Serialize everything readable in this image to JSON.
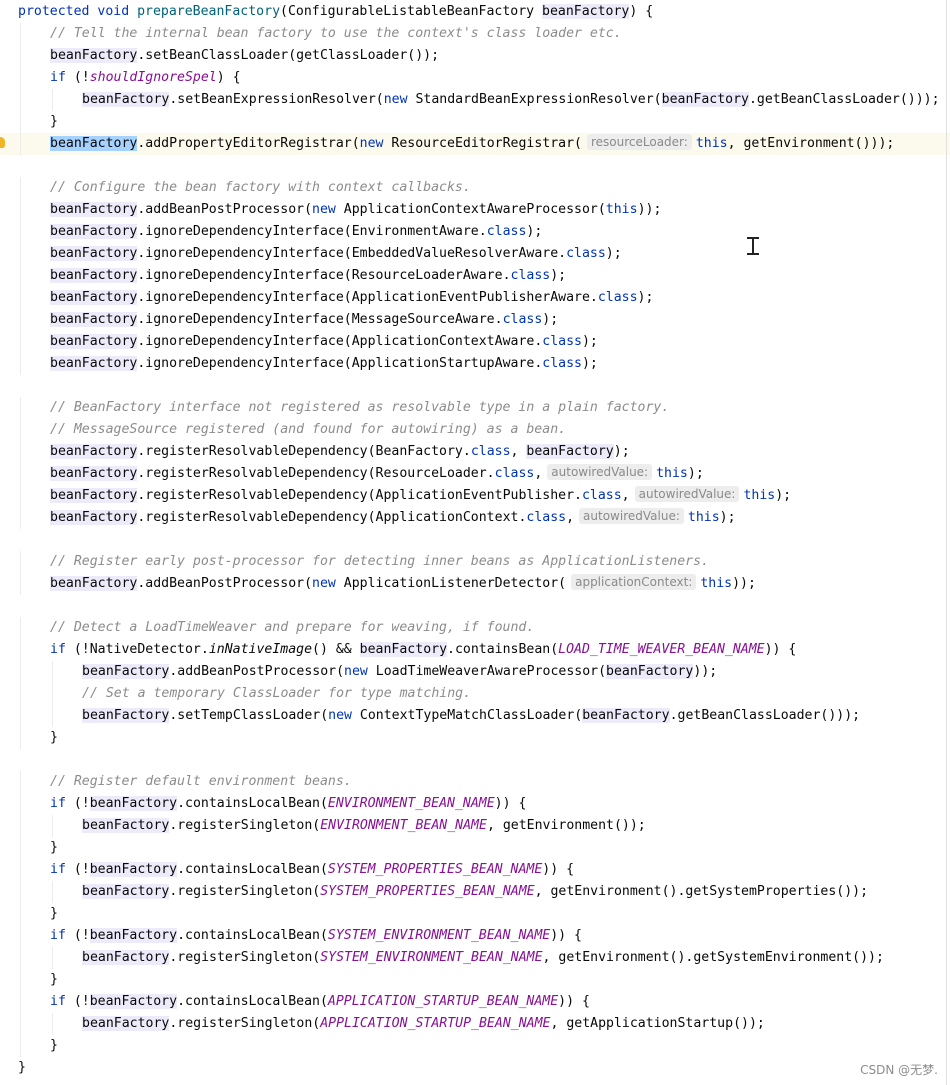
{
  "watermark": "CSDN @无梦.",
  "editor": {
    "caret_line": 6,
    "lines": [
      {
        "indent": 0,
        "tokens": [
          [
            "protected void ",
            "kw"
          ],
          [
            "prepareBeanFactory",
            "method"
          ],
          [
            "(ConfigurableListableBeanFactory ",
            ""
          ],
          [
            "beanFactory",
            "var"
          ],
          [
            ") {",
            ""
          ]
        ]
      },
      {
        "indent": 1,
        "tokens": [
          [
            "// Tell the internal bean factory to use the context's class loader etc.",
            "cm"
          ]
        ]
      },
      {
        "indent": 1,
        "tokens": [
          [
            "beanFactory",
            "var"
          ],
          [
            ".setBeanClassLoader(getClassLoader());",
            ""
          ]
        ]
      },
      {
        "indent": 1,
        "tokens": [
          [
            "if ",
            "kw"
          ],
          [
            "(!",
            ""
          ],
          [
            "shouldIgnoreSpel",
            "fld"
          ],
          [
            ") {",
            ""
          ]
        ]
      },
      {
        "indent": 2,
        "tokens": [
          [
            "beanFactory",
            "var"
          ],
          [
            ".setBeanExpressionResolver(",
            ""
          ],
          [
            "new ",
            "kw"
          ],
          [
            "StandardBeanExpressionResolver(",
            ""
          ],
          [
            "beanFactory",
            "var"
          ],
          [
            ".getBeanClassLoader()));",
            ""
          ]
        ]
      },
      {
        "indent": 1,
        "tokens": [
          [
            "}",
            ""
          ]
        ]
      },
      {
        "indent": 1,
        "tokens": [
          [
            "beanFactory",
            "sel"
          ],
          [
            ".addPropertyEditorRegistrar(",
            ""
          ],
          [
            "new ",
            "kw"
          ],
          [
            "ResourceEditorRegistrar(",
            ""
          ],
          [
            "resourceLoader:",
            "hint"
          ],
          [
            "this",
            "kw"
          ],
          [
            ", getEnvironment()));",
            ""
          ]
        ]
      },
      {
        "indent": 0,
        "tokens": []
      },
      {
        "indent": 1,
        "tokens": [
          [
            "// Configure the bean factory with context callbacks.",
            "cm"
          ]
        ]
      },
      {
        "indent": 1,
        "tokens": [
          [
            "beanFactory",
            "var"
          ],
          [
            ".addBeanPostProcessor(",
            ""
          ],
          [
            "new ",
            "kw"
          ],
          [
            "ApplicationContextAwareProcessor(",
            ""
          ],
          [
            "this",
            "kw"
          ],
          [
            "));",
            ""
          ]
        ]
      },
      {
        "indent": 1,
        "tokens": [
          [
            "beanFactory",
            "var"
          ],
          [
            ".ignoreDependencyInterface(EnvironmentAware.",
            ""
          ],
          [
            "class",
            "kw"
          ],
          [
            ");",
            ""
          ]
        ]
      },
      {
        "indent": 1,
        "tokens": [
          [
            "beanFactory",
            "var"
          ],
          [
            ".ignoreDependencyInterface(EmbeddedValueResolverAware.",
            ""
          ],
          [
            "class",
            "kw"
          ],
          [
            ");",
            ""
          ]
        ]
      },
      {
        "indent": 1,
        "tokens": [
          [
            "beanFactory",
            "var"
          ],
          [
            ".ignoreDependencyInterface(ResourceLoaderAware.",
            ""
          ],
          [
            "class",
            "kw"
          ],
          [
            ");",
            ""
          ]
        ]
      },
      {
        "indent": 1,
        "tokens": [
          [
            "beanFactory",
            "var"
          ],
          [
            ".ignoreDependencyInterface(ApplicationEventPublisherAware.",
            ""
          ],
          [
            "class",
            "kw"
          ],
          [
            ");",
            ""
          ]
        ]
      },
      {
        "indent": 1,
        "tokens": [
          [
            "beanFactory",
            "var"
          ],
          [
            ".ignoreDependencyInterface(MessageSourceAware.",
            ""
          ],
          [
            "class",
            "kw"
          ],
          [
            ");",
            ""
          ]
        ]
      },
      {
        "indent": 1,
        "tokens": [
          [
            "beanFactory",
            "var"
          ],
          [
            ".ignoreDependencyInterface(ApplicationContextAware.",
            ""
          ],
          [
            "class",
            "kw"
          ],
          [
            ");",
            ""
          ]
        ]
      },
      {
        "indent": 1,
        "tokens": [
          [
            "beanFactory",
            "var"
          ],
          [
            ".ignoreDependencyInterface(ApplicationStartupAware.",
            ""
          ],
          [
            "class",
            "kw"
          ],
          [
            ");",
            ""
          ]
        ]
      },
      {
        "indent": 0,
        "tokens": []
      },
      {
        "indent": 1,
        "tokens": [
          [
            "// BeanFactory interface not registered as resolvable type in a plain factory.",
            "cm"
          ]
        ]
      },
      {
        "indent": 1,
        "tokens": [
          [
            "// MessageSource registered (and found for autowiring) as a bean.",
            "cm"
          ]
        ]
      },
      {
        "indent": 1,
        "tokens": [
          [
            "beanFactory",
            "var"
          ],
          [
            ".registerResolvableDependency(BeanFactory.",
            ""
          ],
          [
            "class",
            "kw"
          ],
          [
            ", ",
            ""
          ],
          [
            "beanFactory",
            "var"
          ],
          [
            ");",
            ""
          ]
        ]
      },
      {
        "indent": 1,
        "tokens": [
          [
            "beanFactory",
            "var"
          ],
          [
            ".registerResolvableDependency(ResourceLoader.",
            ""
          ],
          [
            "class",
            "kw"
          ],
          [
            ",",
            ""
          ],
          [
            "autowiredValue:",
            "hint"
          ],
          [
            "this",
            "kw"
          ],
          [
            ");",
            ""
          ]
        ]
      },
      {
        "indent": 1,
        "tokens": [
          [
            "beanFactory",
            "var"
          ],
          [
            ".registerResolvableDependency(ApplicationEventPublisher.",
            ""
          ],
          [
            "class",
            "kw"
          ],
          [
            ",",
            ""
          ],
          [
            "autowiredValue:",
            "hint"
          ],
          [
            "this",
            "kw"
          ],
          [
            ");",
            ""
          ]
        ]
      },
      {
        "indent": 1,
        "tokens": [
          [
            "beanFactory",
            "var"
          ],
          [
            ".registerResolvableDependency(ApplicationContext.",
            ""
          ],
          [
            "class",
            "kw"
          ],
          [
            ",",
            ""
          ],
          [
            "autowiredValue:",
            "hint"
          ],
          [
            "this",
            "kw"
          ],
          [
            ");",
            ""
          ]
        ]
      },
      {
        "indent": 0,
        "tokens": []
      },
      {
        "indent": 1,
        "tokens": [
          [
            "// Register early post-processor for detecting inner beans as ApplicationListeners.",
            "cm"
          ]
        ]
      },
      {
        "indent": 1,
        "tokens": [
          [
            "beanFactory",
            "var"
          ],
          [
            ".addBeanPostProcessor(",
            ""
          ],
          [
            "new ",
            "kw"
          ],
          [
            "ApplicationListenerDetector(",
            ""
          ],
          [
            "applicationContext:",
            "hint"
          ],
          [
            "this",
            "kw"
          ],
          [
            "));",
            ""
          ]
        ]
      },
      {
        "indent": 0,
        "tokens": []
      },
      {
        "indent": 1,
        "tokens": [
          [
            "// Detect a LoadTimeWeaver and prepare for weaving, if found.",
            "cm"
          ]
        ]
      },
      {
        "indent": 1,
        "tokens": [
          [
            "if ",
            "kw"
          ],
          [
            "(!NativeDetector.",
            ""
          ],
          [
            "inNativeImage",
            "ital"
          ],
          [
            "() && ",
            ""
          ],
          [
            "beanFactory",
            "var"
          ],
          [
            ".containsBean(",
            ""
          ],
          [
            "LOAD_TIME_WEAVER_BEAN_NAME",
            "fld"
          ],
          [
            ")) {",
            ""
          ]
        ]
      },
      {
        "indent": 2,
        "tokens": [
          [
            "beanFactory",
            "var"
          ],
          [
            ".addBeanPostProcessor(",
            ""
          ],
          [
            "new ",
            "kw"
          ],
          [
            "LoadTimeWeaverAwareProcessor(",
            ""
          ],
          [
            "beanFactory",
            "var"
          ],
          [
            "));",
            ""
          ]
        ]
      },
      {
        "indent": 2,
        "tokens": [
          [
            "// Set a temporary ClassLoader for type matching.",
            "cm"
          ]
        ]
      },
      {
        "indent": 2,
        "tokens": [
          [
            "beanFactory",
            "var"
          ],
          [
            ".setTempClassLoader(",
            ""
          ],
          [
            "new ",
            "kw"
          ],
          [
            "ContextTypeMatchClassLoader(",
            ""
          ],
          [
            "beanFactory",
            "var"
          ],
          [
            ".getBeanClassLoader()));",
            ""
          ]
        ]
      },
      {
        "indent": 1,
        "tokens": [
          [
            "}",
            ""
          ]
        ]
      },
      {
        "indent": 0,
        "tokens": []
      },
      {
        "indent": 1,
        "tokens": [
          [
            "// Register default environment beans.",
            "cm"
          ]
        ]
      },
      {
        "indent": 1,
        "tokens": [
          [
            "if ",
            "kw"
          ],
          [
            "(!",
            ""
          ],
          [
            "beanFactory",
            "var"
          ],
          [
            ".containsLocalBean(",
            ""
          ],
          [
            "ENVIRONMENT_BEAN_NAME",
            "fld"
          ],
          [
            ")) {",
            ""
          ]
        ]
      },
      {
        "indent": 2,
        "tokens": [
          [
            "beanFactory",
            "var"
          ],
          [
            ".registerSingleton(",
            ""
          ],
          [
            "ENVIRONMENT_BEAN_NAME",
            "fld"
          ],
          [
            ", getEnvironment());",
            ""
          ]
        ]
      },
      {
        "indent": 1,
        "tokens": [
          [
            "}",
            ""
          ]
        ]
      },
      {
        "indent": 1,
        "tokens": [
          [
            "if ",
            "kw"
          ],
          [
            "(!",
            ""
          ],
          [
            "beanFactory",
            "var"
          ],
          [
            ".containsLocalBean(",
            ""
          ],
          [
            "SYSTEM_PROPERTIES_BEAN_NAME",
            "fld"
          ],
          [
            ")) {",
            ""
          ]
        ]
      },
      {
        "indent": 2,
        "tokens": [
          [
            "beanFactory",
            "var"
          ],
          [
            ".registerSingleton(",
            ""
          ],
          [
            "SYSTEM_PROPERTIES_BEAN_NAME",
            "fld"
          ],
          [
            ", getEnvironment().getSystemProperties());",
            ""
          ]
        ]
      },
      {
        "indent": 1,
        "tokens": [
          [
            "}",
            ""
          ]
        ]
      },
      {
        "indent": 1,
        "tokens": [
          [
            "if ",
            "kw"
          ],
          [
            "(!",
            ""
          ],
          [
            "beanFactory",
            "var"
          ],
          [
            ".containsLocalBean(",
            ""
          ],
          [
            "SYSTEM_ENVIRONMENT_BEAN_NAME",
            "fld"
          ],
          [
            ")) {",
            ""
          ]
        ]
      },
      {
        "indent": 2,
        "tokens": [
          [
            "beanFactory",
            "var"
          ],
          [
            ".registerSingleton(",
            ""
          ],
          [
            "SYSTEM_ENVIRONMENT_BEAN_NAME",
            "fld"
          ],
          [
            ", getEnvironment().getSystemEnvironment());",
            ""
          ]
        ]
      },
      {
        "indent": 1,
        "tokens": [
          [
            "}",
            ""
          ]
        ]
      },
      {
        "indent": 1,
        "tokens": [
          [
            "if ",
            "kw"
          ],
          [
            "(!",
            ""
          ],
          [
            "beanFactory",
            "var"
          ],
          [
            ".containsLocalBean(",
            ""
          ],
          [
            "APPLICATION_STARTUP_BEAN_NAME",
            "fld"
          ],
          [
            ")) {",
            ""
          ]
        ]
      },
      {
        "indent": 2,
        "tokens": [
          [
            "beanFactory",
            "var"
          ],
          [
            ".registerSingleton(",
            ""
          ],
          [
            "APPLICATION_STARTUP_BEAN_NAME",
            "fld"
          ],
          [
            ", getApplicationStartup());",
            ""
          ]
        ]
      },
      {
        "indent": 1,
        "tokens": [
          [
            "}",
            ""
          ]
        ]
      },
      {
        "indent": 0,
        "tokens": [
          [
            "}",
            ""
          ]
        ]
      }
    ]
  }
}
